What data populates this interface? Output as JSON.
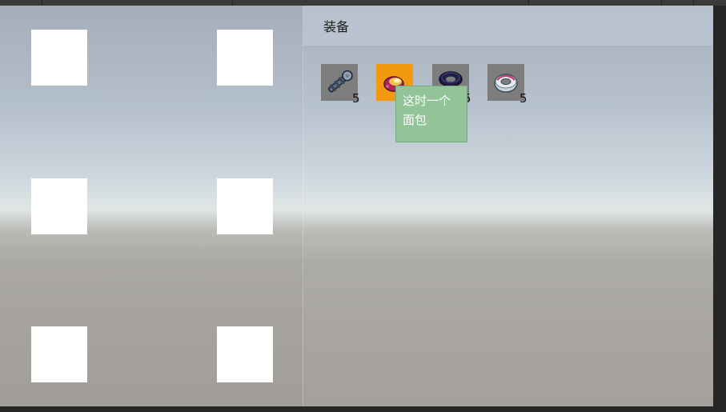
{
  "inventory": {
    "title": "装备",
    "items": [
      {
        "name": "wrench",
        "icon": "wrench-icon",
        "count": "5"
      },
      {
        "name": "bread",
        "icon": "bread-icon",
        "count": "",
        "selected": true
      },
      {
        "name": "tire",
        "icon": "tire-icon",
        "count": "5"
      },
      {
        "name": "tape",
        "icon": "tape-roll-icon",
        "count": "5"
      }
    ],
    "tooltip": {
      "line1": "这时一个",
      "line2": "面包"
    }
  },
  "colors": {
    "selected_slot": "#f19a0f",
    "slot": "#7d7d7d",
    "tooltip_bg": "#92c498"
  }
}
